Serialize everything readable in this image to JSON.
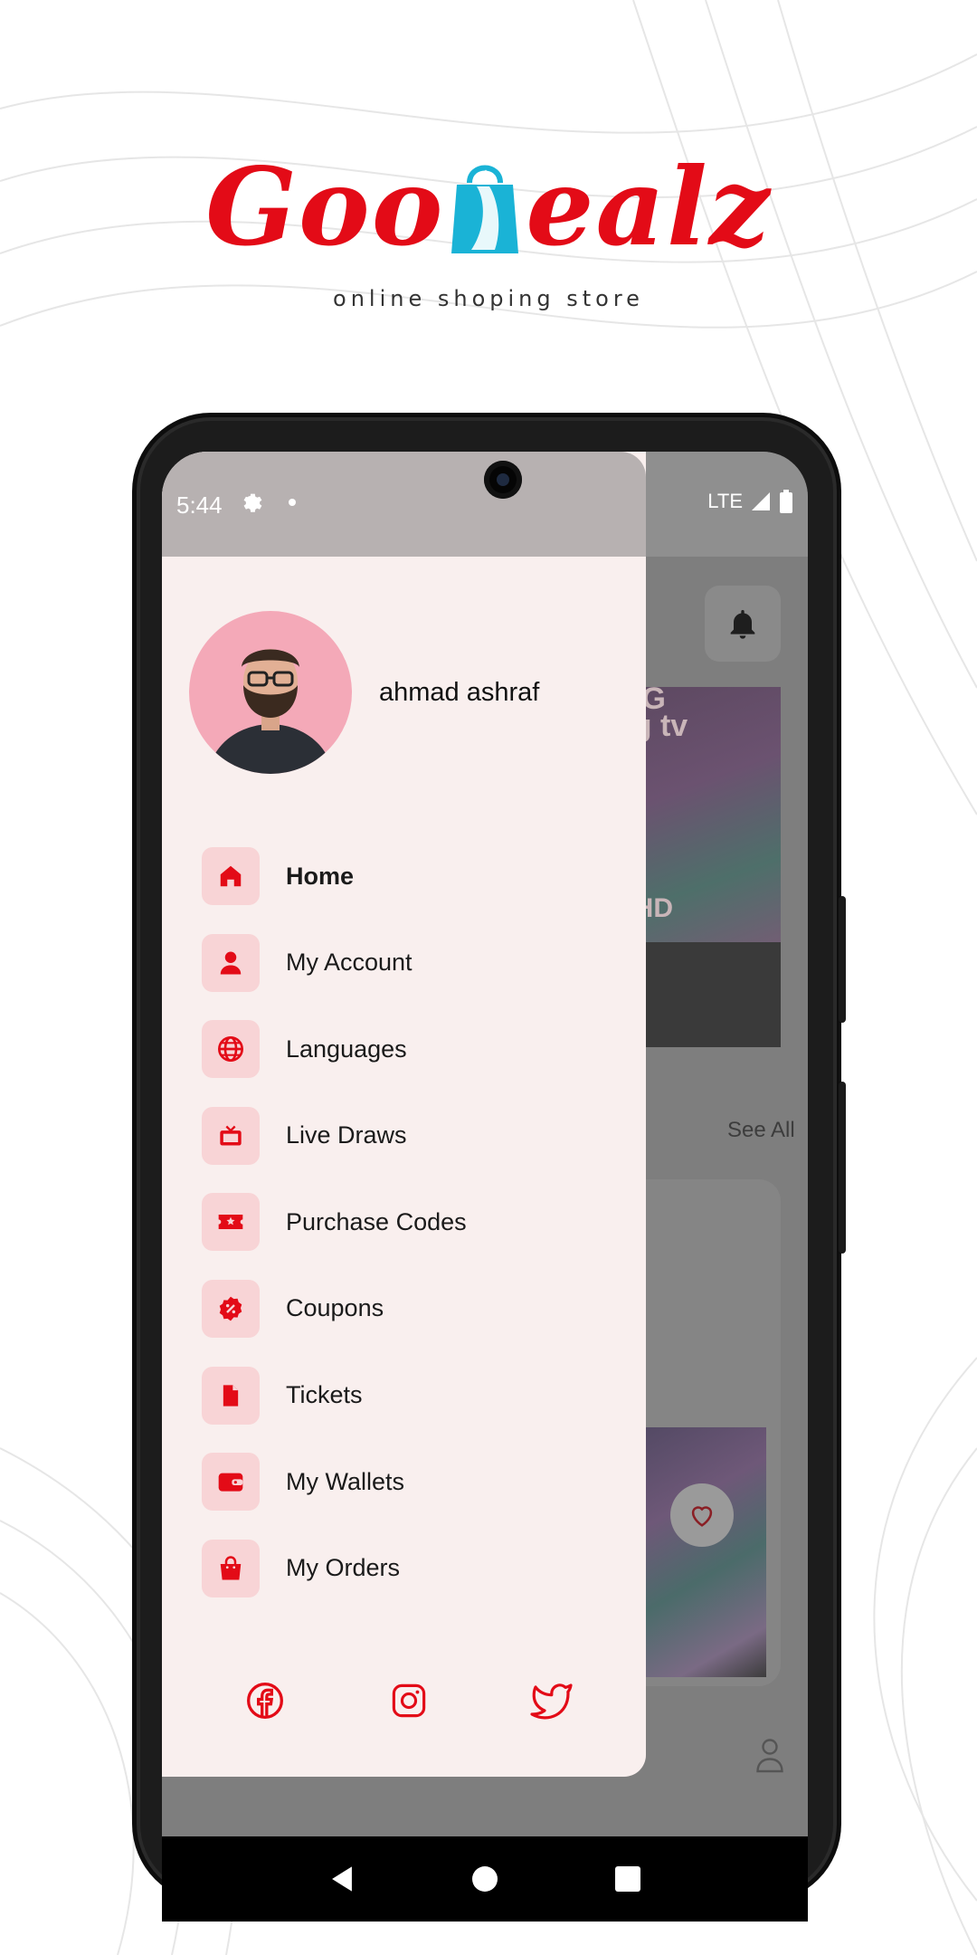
{
  "brand": {
    "name_part1": "Goo",
    "name_part2": "ealz",
    "tagline": "online shoping store",
    "colors": {
      "red": "#e30b17",
      "bag_blue": "#1ab3d6"
    }
  },
  "status_bar": {
    "time": "5:44",
    "network": "LTE",
    "icons": [
      "gear-icon",
      "dot-icon",
      "signal-icon",
      "battery-icon"
    ]
  },
  "drawer": {
    "user_name": "ahmad ashraf",
    "menu": [
      {
        "label": "Home",
        "icon": "home-icon",
        "active": true
      },
      {
        "label": "My Account",
        "icon": "person-icon"
      },
      {
        "label": "Languages",
        "icon": "globe-icon"
      },
      {
        "label": "Live Draws",
        "icon": "tv-icon"
      },
      {
        "label": "Purchase Codes",
        "icon": "ticket-icon"
      },
      {
        "label": "Coupons",
        "icon": "discount-badge-icon"
      },
      {
        "label": "Tickets",
        "icon": "document-icon"
      },
      {
        "label": "My Wallets",
        "icon": "wallet-icon"
      },
      {
        "label": "My Orders",
        "icon": "shopping-bag-icon"
      }
    ],
    "socials": [
      "facebook-icon",
      "instagram-icon",
      "twitter-icon"
    ]
  },
  "background_app": {
    "banner_line1": "NG",
    "banner_line2": "ng tv",
    "banner_badge": "UHD",
    "see_all": "See All"
  },
  "navigation_bar": [
    "back-icon",
    "home-circle-icon",
    "recents-icon"
  ]
}
